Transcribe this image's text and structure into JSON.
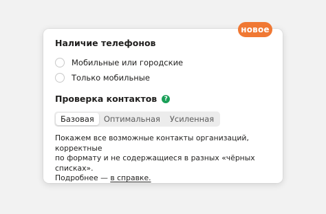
{
  "badge": "новое",
  "phones": {
    "title": "Наличие телефонов",
    "options": [
      "Мобильные или городские",
      "Только мобильные"
    ]
  },
  "contacts": {
    "title": "Проверка контактов",
    "help_icon": "question-icon",
    "help_symbol": "?",
    "tabs": [
      "Базовая",
      "Оптимальная",
      "Усиленная"
    ],
    "selected_tab": "Базовая",
    "description_line1": "Покажем все возможные контакты организаций, корректные",
    "description_line2": "по формату и не содержащиеся в разных «чёрных списках».",
    "more_prefix": "Подробнее — ",
    "more_link": "в справке."
  },
  "colors": {
    "badge": "#f07833",
    "help_icon": "#1a9f58"
  }
}
